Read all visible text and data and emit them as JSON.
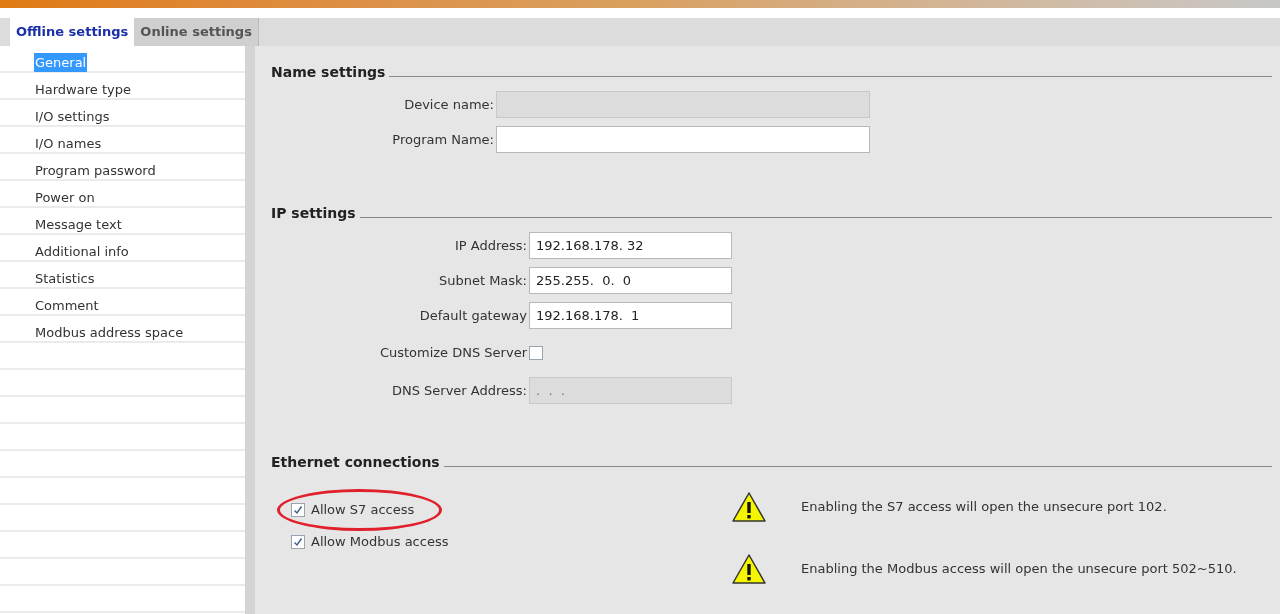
{
  "tabs": [
    {
      "label": "Offline settings",
      "selected": true
    },
    {
      "label": "Online settings",
      "selected": false
    }
  ],
  "sidebar": {
    "items": [
      {
        "label": "General",
        "selected": true
      },
      {
        "label": "Hardware type",
        "selected": false
      },
      {
        "label": "I/O settings",
        "selected": false
      },
      {
        "label": "I/O names",
        "selected": false
      },
      {
        "label": "Program password",
        "selected": false
      },
      {
        "label": "Power on",
        "selected": false
      },
      {
        "label": "Message text",
        "selected": false
      },
      {
        "label": "Additional info",
        "selected": false
      },
      {
        "label": "Statistics",
        "selected": false
      },
      {
        "label": "Comment",
        "selected": false
      },
      {
        "label": "Modbus address space",
        "selected": false
      }
    ]
  },
  "name_settings": {
    "title": "Name settings",
    "fields": [
      {
        "label": "Device name:",
        "disabled": true
      },
      {
        "label": "Program Name:",
        "disabled": false
      }
    ]
  },
  "ip_settings": {
    "title": "IP settings",
    "fields": [
      {
        "kind": "text",
        "label": "IP Address:",
        "value": "192.168.178. 32",
        "disabled": false
      },
      {
        "kind": "text",
        "label": "Subnet Mask:",
        "value": "255.255.  0.  0",
        "disabled": false
      },
      {
        "kind": "text",
        "label": "Default gateway",
        "value": "192.168.178.  1",
        "disabled": false
      },
      {
        "kind": "checkbox",
        "label": "Customize DNS Server",
        "checked": false
      },
      {
        "kind": "text",
        "label": "DNS Server Address:",
        "value": ".  .  .",
        "disabled": true
      }
    ]
  },
  "ethernet_connections": {
    "title": "Ethernet connections",
    "options": [
      {
        "label": "Allow S7 access",
        "checked": true,
        "highlighted": true
      },
      {
        "label": "Allow Modbus access",
        "checked": true,
        "highlighted": false
      }
    ],
    "warnings": [
      "Enabling the S7 access will open the unsecure port 102.",
      "Enabling the Modbus access will open the unsecure port 502~510."
    ]
  }
}
